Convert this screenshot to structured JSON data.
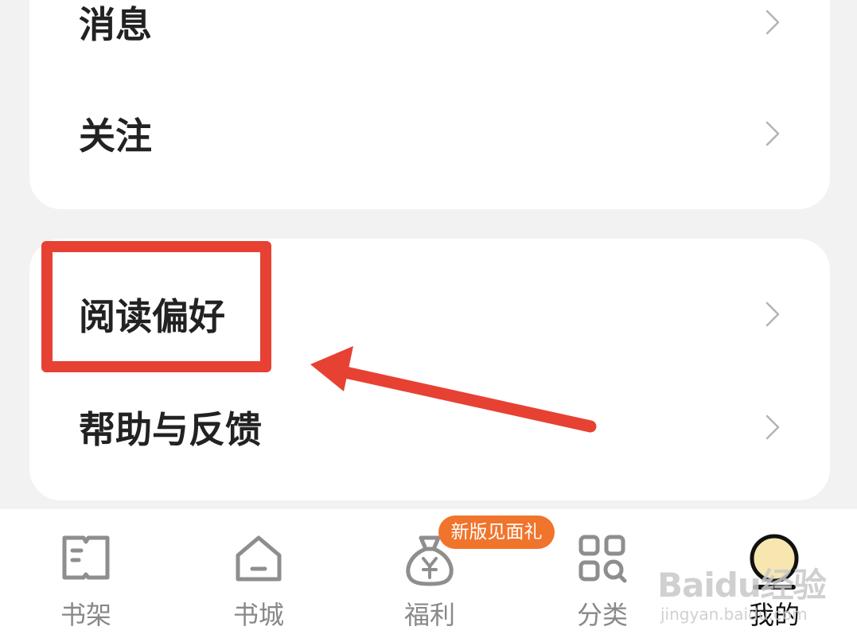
{
  "menu": {
    "group1": [
      {
        "label": "消息"
      },
      {
        "label": "关注"
      }
    ],
    "group2": [
      {
        "label": "阅读偏好"
      },
      {
        "label": "帮助与反馈"
      }
    ]
  },
  "tabbar": {
    "tabs": [
      {
        "label": "书架",
        "icon": "book-icon"
      },
      {
        "label": "书城",
        "icon": "home-icon"
      },
      {
        "label": "福利",
        "icon": "money-bag-icon",
        "badge": "新版见面礼"
      },
      {
        "label": "分类",
        "icon": "grid-search-icon"
      },
      {
        "label": "我的",
        "icon": "avatar-icon",
        "active": true
      }
    ]
  },
  "annotation": {
    "highlight_color": "#e74133",
    "target": "阅读偏好"
  },
  "watermark": {
    "main": "Baidu经验",
    "sub": "jingyan.baidu.com"
  },
  "colors": {
    "background": "#f2f2f2",
    "card": "#ffffff",
    "badge": "#f0742c",
    "tab_inactive": "#888888",
    "tab_active": "#111111"
  }
}
